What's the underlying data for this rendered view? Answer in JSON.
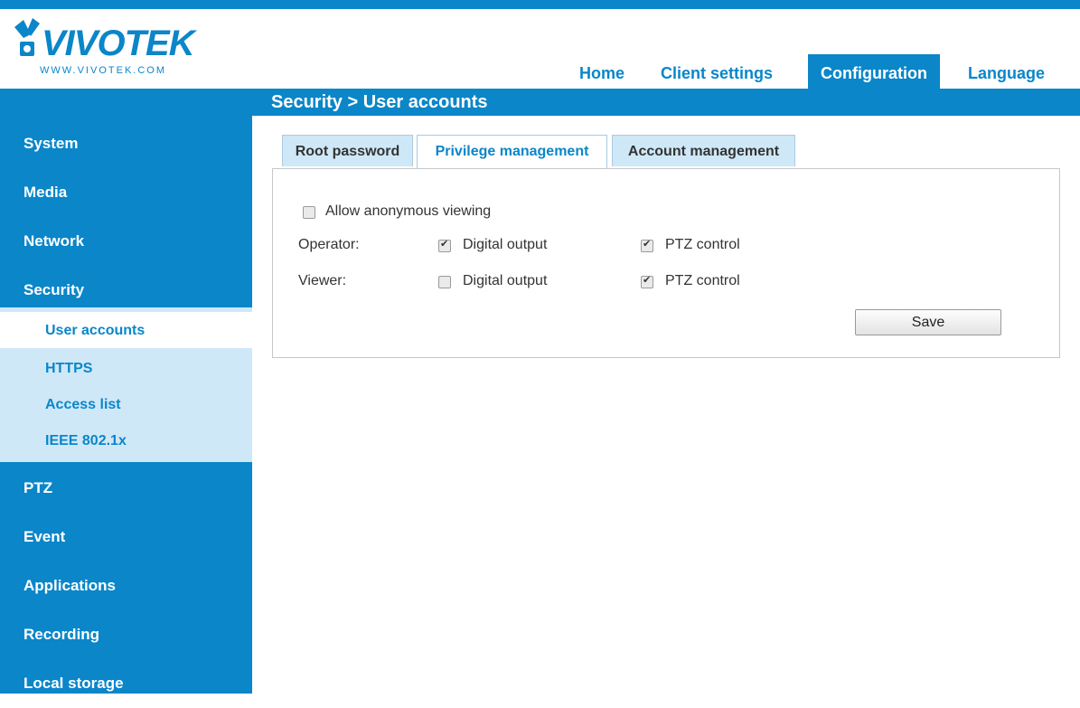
{
  "brand": {
    "logo_text": "VIVOTEK",
    "logo_url": "WWW.VIVOTEK.COM",
    "accent_color": "#0a86c9"
  },
  "nav": {
    "home": "Home",
    "client_settings": "Client settings",
    "configuration": "Configuration",
    "language": "Language"
  },
  "breadcrumb": "Security  > User accounts",
  "sidebar": {
    "items": [
      "System",
      "Media",
      "Network",
      "Security"
    ],
    "security_sub": [
      "User accounts",
      "HTTPS",
      "Access list",
      "IEEE 802.1x"
    ],
    "items_after": [
      "PTZ",
      "Event",
      "Applications",
      "Recording",
      "Local storage"
    ]
  },
  "tabs": [
    "Root password",
    "Privilege management",
    "Account management"
  ],
  "panel": {
    "anonymous_label": "Allow anonymous viewing",
    "anonymous_checked": false,
    "operator": {
      "label": "Operator:",
      "digital_output": "Digital output",
      "digital_output_checked": true,
      "ptz_control": "PTZ control",
      "ptz_control_checked": true
    },
    "viewer": {
      "label": "Viewer:",
      "digital_output": "Digital output",
      "digital_output_checked": false,
      "ptz_control": "PTZ control",
      "ptz_control_checked": true
    },
    "save_label": "Save"
  }
}
